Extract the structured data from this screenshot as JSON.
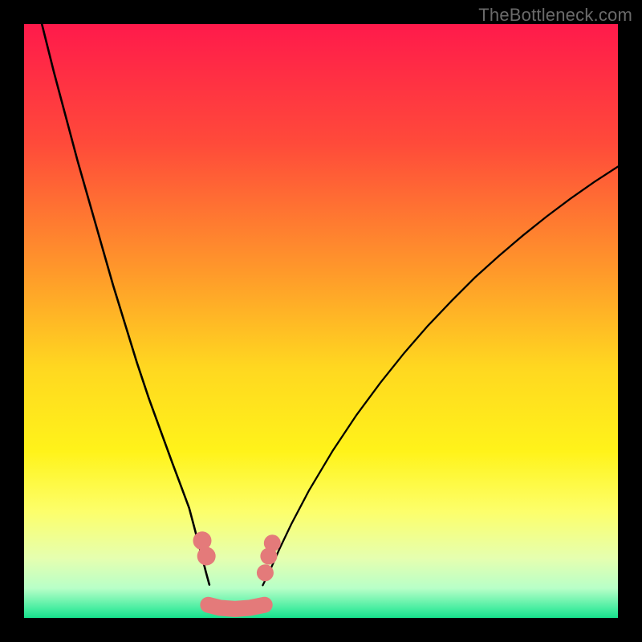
{
  "watermark": {
    "text": "TheBottleneck.com"
  },
  "chart_data": {
    "type": "line",
    "title": "",
    "xlabel": "",
    "ylabel": "",
    "legend": false,
    "grid": false,
    "background": {
      "gradient_stops": [
        {
          "offset": 0.0,
          "color": "#ff1a4b"
        },
        {
          "offset": 0.2,
          "color": "#ff4a3a"
        },
        {
          "offset": 0.42,
          "color": "#ff9a2a"
        },
        {
          "offset": 0.58,
          "color": "#ffd820"
        },
        {
          "offset": 0.72,
          "color": "#fff31a"
        },
        {
          "offset": 0.82,
          "color": "#fdff6a"
        },
        {
          "offset": 0.9,
          "color": "#e5ffb0"
        },
        {
          "offset": 0.95,
          "color": "#b8ffc8"
        },
        {
          "offset": 0.985,
          "color": "#45eda0"
        },
        {
          "offset": 1.0,
          "color": "#17e08c"
        }
      ],
      "green_band": {
        "y_from": 0.0,
        "y_to": 0.03,
        "color": "#17e08c"
      },
      "pale_band": {
        "y_from": 0.03,
        "y_to": 0.12
      }
    },
    "xlim": [
      0,
      100
    ],
    "ylim": [
      0,
      100
    ],
    "series": [
      {
        "name": "left-curve",
        "stroke": "#000000",
        "stroke_width": 2.6,
        "x": [
          3,
          5,
          7,
          9,
          11,
          13,
          15,
          17,
          19,
          21,
          23,
          25,
          26.5,
          27.8,
          28.6,
          29.3,
          30.0,
          30.6,
          31.2
        ],
        "y": [
          100,
          92,
          84.5,
          77,
          70,
          63,
          56,
          49.5,
          43,
          37,
          31.5,
          26,
          22,
          18.5,
          15.5,
          12.8,
          10.2,
          7.8,
          5.6
        ]
      },
      {
        "name": "right-curve",
        "stroke": "#000000",
        "stroke_width": 2.3,
        "x": [
          40.2,
          41.5,
          43,
          45,
          48,
          52,
          56,
          60,
          64,
          68,
          72,
          76,
          80,
          84,
          88,
          92,
          96,
          100
        ],
        "y": [
          5.5,
          8.2,
          11.6,
          15.8,
          21.5,
          28.2,
          34.2,
          39.6,
          44.6,
          49.2,
          53.4,
          57.4,
          61.0,
          64.4,
          67.6,
          70.6,
          73.4,
          76.0
        ]
      },
      {
        "name": "valley-bottom",
        "stroke": "#e47a7a",
        "stroke_width": 20,
        "linecap": "round",
        "x": [
          31.0,
          33.0,
          35.5,
          38.0,
          40.5
        ],
        "y": [
          2.2,
          1.7,
          1.5,
          1.7,
          2.2
        ]
      }
    ],
    "markers": [
      {
        "name": "left-dot-upper",
        "x": 30.0,
        "y": 13.0,
        "r": 11.5,
        "fill": "#e47a7a"
      },
      {
        "name": "left-dot-lower",
        "x": 30.7,
        "y": 10.4,
        "r": 11.5,
        "fill": "#e47a7a"
      },
      {
        "name": "right-dot-upper",
        "x": 41.8,
        "y": 12.6,
        "r": 10.5,
        "fill": "#e47a7a"
      },
      {
        "name": "right-dot-mid",
        "x": 41.2,
        "y": 10.4,
        "r": 10.5,
        "fill": "#e47a7a"
      },
      {
        "name": "right-dot-lower",
        "x": 40.6,
        "y": 7.6,
        "r": 10.5,
        "fill": "#e47a7a"
      }
    ]
  }
}
